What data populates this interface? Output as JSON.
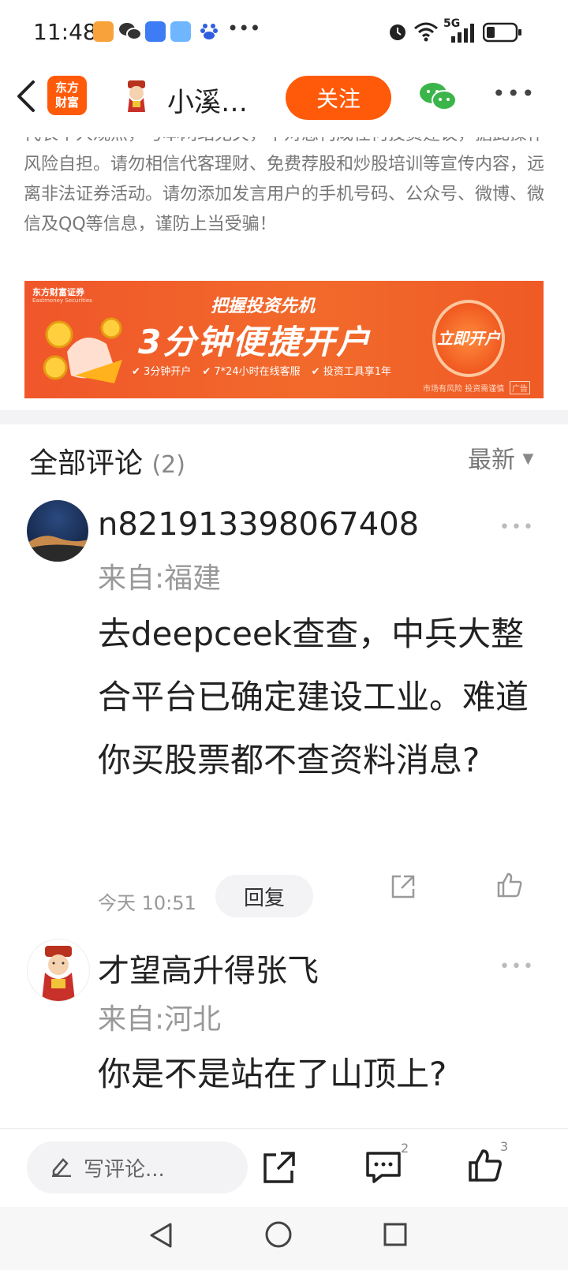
{
  "status_bar": {
    "time": "11:48",
    "network": "5G",
    "icons": [
      "paw-app-icon",
      "wechat-icon",
      "taobao-icon",
      "weather-icon",
      "baidu-icon",
      "more-dots-icon",
      "alarm-icon",
      "wifi-icon",
      "signal-icon",
      "battery-icon"
    ]
  },
  "header": {
    "app_logo_text": "东方\n财富",
    "author_name": "小溪…",
    "follow_label": "关注"
  },
  "disclaimer": {
    "text": "代表个人观点，与本网站无关，不对您构成任何投资建议，据此操作风险自担。请勿相信代客理财、免费荐股和炒股培训等宣传内容，远离非法证券活动。请勿添加发言用户的手机号码、公众号、微博、微信及QQ等信息，谨防上当受骗！"
  },
  "banner": {
    "brand": "东方财富证券",
    "brand_en": "Eastmoney Securities",
    "headline": "把握投资先机",
    "main": "3分钟便捷开户",
    "features": [
      "3分钟开户",
      "7*24小时在线客服",
      "投资工具享1年"
    ],
    "cta": "立即开户",
    "risk_note": "市场有风险 投资需谨慎",
    "ad_tag": "广告"
  },
  "comments": {
    "title": "全部评论",
    "count": "(2)",
    "sort_label": "最新",
    "items": [
      {
        "user": "n821913398067408",
        "location": "来自:福建",
        "text": "去deepceek查查，中兵大整合平台已确定建设工业。难道你买股票都不查资料消息?",
        "time": "今天 10:51",
        "reply_label": "回复",
        "more": "•••"
      },
      {
        "user": "才望高升得张飞",
        "location": "来自:河北",
        "text": "你是不是站在了山顶上?",
        "more": "•••"
      }
    ]
  },
  "bottom_bar": {
    "write_placeholder": "写评论...",
    "comment_count": "2",
    "like_count": "3"
  },
  "colors": {
    "accent": "#ff5a0a",
    "wechat_green": "#3bb54a"
  }
}
